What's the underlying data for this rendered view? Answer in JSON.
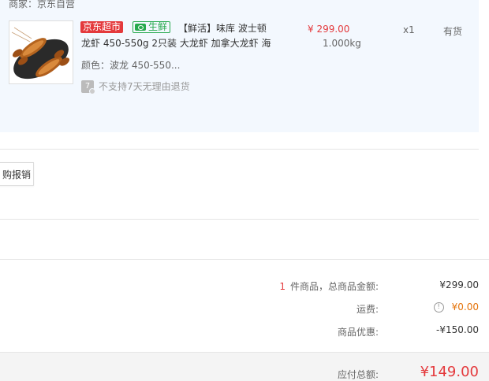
{
  "merchant": {
    "line": "商家：京东自营"
  },
  "product": {
    "badges": {
      "jd_supermarket": "京东超市",
      "fresh": "生鲜"
    },
    "title_line1": "【鲜活】味库 波士顿",
    "title_line2": "龙虾 450-550g 2只装 大龙虾 加拿大龙虾 海",
    "color_spec": "颜色：波龙 450-550...",
    "return_notice": "不支持7天无理由退货",
    "return_icon_text": "7",
    "unit_price": "¥ 299.00",
    "weight": "1.000kg",
    "quantity": "x1",
    "stock": "有货"
  },
  "reimburse_button": "购报销",
  "summary": {
    "item_count": "1",
    "count_label": "件商品，总商品金额:",
    "subtotal": "¥299.00",
    "shipping_label": "运费:",
    "shipping": "¥0.00",
    "discount_label": "商品优惠:",
    "discount": "-¥150.00",
    "total_label": "应付总额:",
    "total": "¥149.00"
  },
  "icons": {
    "fresh": "fresh-fish-icon",
    "return": "seven-day-return-icon",
    "shipping_info": "info-icon"
  },
  "colors": {
    "price_red": "#e4393c",
    "fresh_green": "#26a94d",
    "shipping_orange": "#e4730a",
    "product_panel_bg": "#f3f8fe"
  }
}
